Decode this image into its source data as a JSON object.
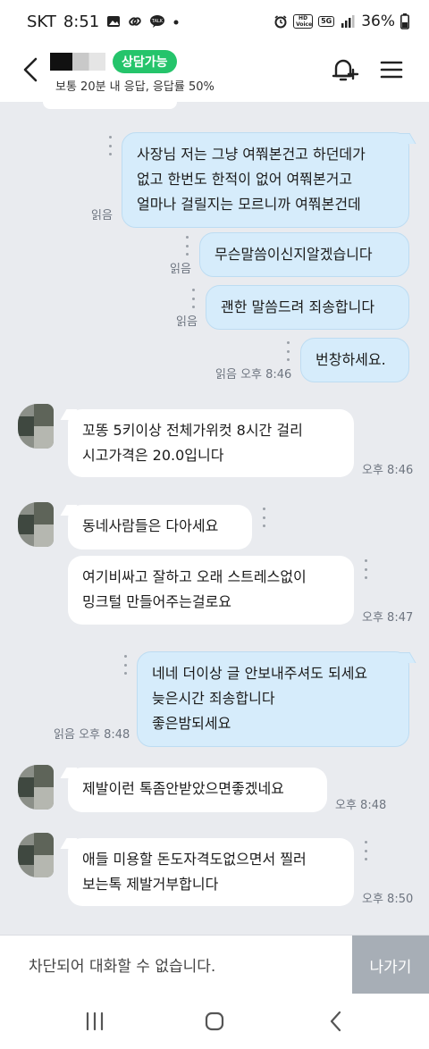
{
  "status_bar": {
    "carrier": "SKT",
    "time": "8:51",
    "volte_badge": "HD Voice",
    "network_badge": "5G",
    "battery": "36%"
  },
  "header": {
    "badge": "상담가능",
    "subtitle": "보통 20분 내 응답, 응답률 50%"
  },
  "messages": [
    {
      "side": "me",
      "lines": [
        "사장님 저는 그냥 여쭤본건고 하던데가",
        "없고 한번도 한적이 없어 여쭤본거고",
        "얼마나 걸릴지는 모르니까 여쭤본건데"
      ],
      "read": "읽음",
      "time": ""
    },
    {
      "side": "me",
      "lines": [
        "무슨말씀이신지알겠습니다"
      ],
      "read": "읽음",
      "time": ""
    },
    {
      "side": "me",
      "lines": [
        "괜한 말씀드려 죄송합니다"
      ],
      "read": "읽음",
      "time": ""
    },
    {
      "side": "me",
      "lines": [
        "번창하세요."
      ],
      "read": "읽음",
      "time": "오후 8:46"
    },
    {
      "side": "them",
      "lines": [
        "꼬똥 5키이상 전체가위컷 8시간 걸리",
        "시고가격은 20.0입니다"
      ],
      "time": "오후 8:46"
    },
    {
      "side": "them",
      "lines": [
        "동네사람들은 다아세요"
      ],
      "time": ""
    },
    {
      "side": "them",
      "lines": [
        "여기비싸고 잘하고 오래 스트레스없이",
        "밍크털 만들어주는걸로요"
      ],
      "time": "오후 8:47"
    },
    {
      "side": "me",
      "lines": [
        "네네 더이상 글 안보내주셔도 되세요",
        "늦은시간 죄송합니다",
        "좋은밤되세요"
      ],
      "read": "읽음",
      "time": "오후 8:48"
    },
    {
      "side": "them",
      "lines": [
        "제발이런 톡좀안받았으면좋겠네요"
      ],
      "time": "오후 8:48"
    },
    {
      "side": "them",
      "lines": [
        "애들 미용할 돈도자격도없으면서 찔러",
        "보는톡 제발거부합니다"
      ],
      "time": "오후 8:50"
    }
  ],
  "footer": {
    "blocked_text": "차단되어 대화할 수 없습니다.",
    "leave_label": "나가기"
  },
  "icons": {
    "back": "chevron-left-icon",
    "bell": "bell-plus-icon",
    "menu": "hamburger-menu-icon",
    "nav_recent": "recent-apps-icon",
    "nav_home": "home-icon",
    "nav_back": "back-icon"
  },
  "colors": {
    "badge_green": "#25c46b",
    "my_bubble": "#d6ecfb",
    "their_bubble": "#ffffff",
    "chat_bg": "#e9ebef",
    "leave_button": "#a7aeb6"
  }
}
